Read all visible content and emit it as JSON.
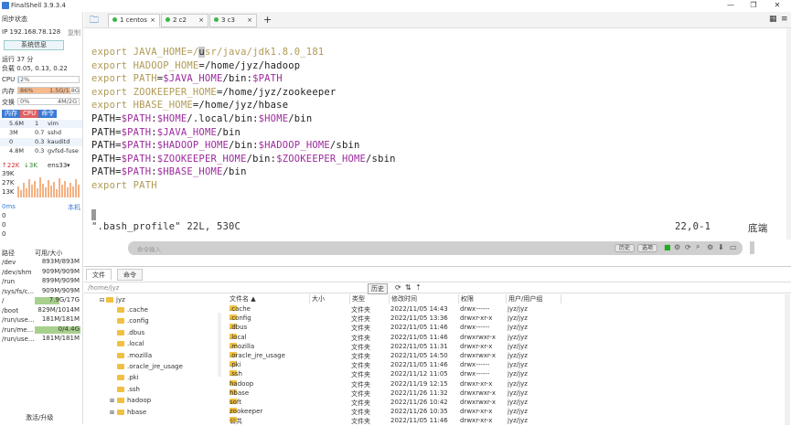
{
  "window": {
    "title": "FinalShell 3.9.3.4"
  },
  "left": {
    "sync_status": "同步状态",
    "ip": "IP 192.168.78.128",
    "copy": "复制",
    "sysinfo_button": "系统信息",
    "uptime": "运行 37 分",
    "load": "负载 0.05, 0.13, 0.22",
    "cpu_label": "CPU",
    "cpu_value": "2%",
    "cpu_fraction": 0.02,
    "mem_label": "内存",
    "mem_pct": "86%",
    "mem_value": "1.5G/1.8G",
    "mem_fraction": 0.86,
    "swap_label": "交换",
    "swap_pct": "0%",
    "swap_value": "4M/2G",
    "proc_tabs": [
      "内存",
      "CPU",
      "命令"
    ],
    "procs": [
      {
        "mem": "5.6M",
        "cpu": "1",
        "cmd": "vim"
      },
      {
        "mem": "3M",
        "cpu": "0.7",
        "cmd": "sshd"
      },
      {
        "mem": "0",
        "cpu": "0.3",
        "cmd": "kauditd"
      },
      {
        "mem": "4.8M",
        "cpu": "0.3",
        "cmd": "gvfsd-fuse"
      }
    ],
    "net_up": "↑22K",
    "net_down": "↓3K",
    "net_if": "ens33",
    "net_scale": [
      "39K",
      "27K",
      "13K"
    ],
    "ping": "0ms",
    "ping_local": "本机",
    "zeros": [
      "0",
      "0",
      "0"
    ],
    "disk_headers": [
      "路径",
      "可用/大小"
    ],
    "disks": [
      {
        "path": "/dev",
        "size": "893M/893M",
        "fraction": 0
      },
      {
        "path": "/dev/shm",
        "size": "909M/909M",
        "fraction": 0
      },
      {
        "path": "/run",
        "size": "899M/909M",
        "fraction": 0
      },
      {
        "path": "/sys/fs/c...",
        "size": "909M/909M",
        "fraction": 0
      },
      {
        "path": "/",
        "size": "7.9G/17G",
        "fraction": 0.54
      },
      {
        "path": "/boot",
        "size": "829M/1014M",
        "fraction": 0
      },
      {
        "path": "/run/use...",
        "size": "181M/181M",
        "fraction": 0
      },
      {
        "path": "/run/me...",
        "size": "0/4.4G",
        "fraction": 1.0
      },
      {
        "path": "/run/use...",
        "size": "181M/181M",
        "fraction": 0
      }
    ],
    "upgrade": "激活/升级"
  },
  "tabs": [
    {
      "label": "1 centos",
      "active": true
    },
    {
      "label": "2 c2",
      "active": false
    },
    {
      "label": "3 c3",
      "active": false
    }
  ],
  "terminal": {
    "lines": [
      [
        {
          "t": "export ",
          "c": "kw"
        },
        {
          "t": "JAVA_HOME",
          "c": "kw"
        },
        {
          "t": "=/",
          "c": "kw"
        },
        {
          "t": "u",
          "c": "df"
        },
        {
          "t": "sr/java/jdk1.8.0_181",
          "c": "kw"
        }
      ],
      [
        {
          "t": "export ",
          "c": "kw"
        },
        {
          "t": "HADOOP_HOME",
          "c": "kw"
        },
        {
          "t": "=/home/jyz/hadoop",
          "c": "df"
        }
      ],
      [
        {
          "t": "export ",
          "c": "kw"
        },
        {
          "t": "PATH",
          "c": "kw"
        },
        {
          "t": "=",
          "c": "df"
        },
        {
          "t": "$JAVA_HOME",
          "c": "vr"
        },
        {
          "t": "/bin:",
          "c": "df"
        },
        {
          "t": "$PATH",
          "c": "vr"
        }
      ],
      [
        {
          "t": "export ",
          "c": "kw"
        },
        {
          "t": "ZOOKEEPER_HOME",
          "c": "kw"
        },
        {
          "t": "=/home/jyz/zookeeper",
          "c": "df"
        }
      ],
      [
        {
          "t": "export ",
          "c": "kw"
        },
        {
          "t": "HBASE_HOME",
          "c": "kw"
        },
        {
          "t": "=/home/jyz/hbase",
          "c": "df"
        }
      ],
      [
        {
          "t": "PATH",
          "c": "df"
        },
        {
          "t": "=",
          "c": "df"
        },
        {
          "t": "$PATH",
          "c": "vr"
        },
        {
          "t": ":",
          "c": "df"
        },
        {
          "t": "$HOME",
          "c": "vr"
        },
        {
          "t": "/.local/bin:",
          "c": "df"
        },
        {
          "t": "$HOME",
          "c": "vr"
        },
        {
          "t": "/bin",
          "c": "df"
        }
      ],
      [
        {
          "t": "PATH",
          "c": "df"
        },
        {
          "t": "=",
          "c": "df"
        },
        {
          "t": "$PATH",
          "c": "vr"
        },
        {
          "t": ":",
          "c": "df"
        },
        {
          "t": "$JAVA_HOME",
          "c": "vr"
        },
        {
          "t": "/bin",
          "c": "df"
        }
      ],
      [
        {
          "t": "PATH",
          "c": "df"
        },
        {
          "t": "=",
          "c": "df"
        },
        {
          "t": "$PATH",
          "c": "vr"
        },
        {
          "t": ":",
          "c": "df"
        },
        {
          "t": "$HADOOP_HOME",
          "c": "vr"
        },
        {
          "t": "/bin:",
          "c": "df"
        },
        {
          "t": "$HADOOP_HOME",
          "c": "vr"
        },
        {
          "t": "/sbin",
          "c": "df"
        }
      ],
      [
        {
          "t": "PATH",
          "c": "df"
        },
        {
          "t": "=",
          "c": "df"
        },
        {
          "t": "$PATH",
          "c": "vr"
        },
        {
          "t": ":",
          "c": "df"
        },
        {
          "t": "$ZOOKEEPER_HOME",
          "c": "vr"
        },
        {
          "t": "/bin:",
          "c": "df"
        },
        {
          "t": "$ZOOKEEPER_HOME",
          "c": "vr"
        },
        {
          "t": "/sbin",
          "c": "df"
        }
      ],
      [
        {
          "t": "PATH",
          "c": "df"
        },
        {
          "t": "=",
          "c": "df"
        },
        {
          "t": "$PATH",
          "c": "vr"
        },
        {
          "t": ":",
          "c": "df"
        },
        {
          "t": "$HBASE_HOME",
          "c": "vr"
        },
        {
          "t": "/bin",
          "c": "df"
        }
      ],
      [
        {
          "t": "export ",
          "c": "kw"
        },
        {
          "t": "PATH",
          "c": "kw"
        }
      ]
    ],
    "status_left": "\".bash_profile\" 22L, 530C",
    "status_pos": "22,0-1",
    "status_right": "底端",
    "cmd_placeholder": "命令输入",
    "history_btn": "历史",
    "options_btn": "选项"
  },
  "bottom": {
    "tabs": [
      "文件",
      "命令"
    ],
    "path": "/home/jyz",
    "history_btn": "历史",
    "tree_root": "jyz",
    "tree": [
      ".cache",
      ".config",
      ".dbus",
      ".local",
      ".mozilla",
      ".oracle_jre_usage",
      ".pki",
      ".ssh",
      "hadoop",
      "hbase"
    ],
    "columns": [
      "文件名 ▲",
      "大小",
      "类型",
      "修改时间",
      "权限",
      "用户/用户组"
    ],
    "files": [
      {
        "name": ".cache",
        "type": "文件夹",
        "time": "2022/11/05 14:43",
        "perm": "drwx------",
        "owner": "jyz/jyz"
      },
      {
        "name": ".config",
        "type": "文件夹",
        "time": "2022/11/05 13:36",
        "perm": "drwxr-xr-x",
        "owner": "jyz/jyz"
      },
      {
        "name": ".dbus",
        "type": "文件夹",
        "time": "2022/11/05 11:46",
        "perm": "drwx------",
        "owner": "jyz/jyz"
      },
      {
        "name": ".local",
        "type": "文件夹",
        "time": "2022/11/05 11:46",
        "perm": "drwxrwxr-x",
        "owner": "jyz/jyz"
      },
      {
        "name": ".mozilla",
        "type": "文件夹",
        "time": "2022/11/05 11:31",
        "perm": "drwxr-xr-x",
        "owner": "jyz/jyz"
      },
      {
        "name": ".oracle_jre_usage",
        "type": "文件夹",
        "time": "2022/11/05 14:50",
        "perm": "drwxrwxr-x",
        "owner": "jyz/jyz"
      },
      {
        "name": ".pki",
        "type": "文件夹",
        "time": "2022/11/05 11:46",
        "perm": "drwx------",
        "owner": "jyz/jyz"
      },
      {
        "name": ".ssh",
        "type": "文件夹",
        "time": "2022/11/12 11:05",
        "perm": "drwx------",
        "owner": "jyz/jyz"
      },
      {
        "name": "hadoop",
        "type": "文件夹",
        "time": "2022/11/19 12:15",
        "perm": "drwxr-xr-x",
        "owner": "jyz/jyz"
      },
      {
        "name": "hbase",
        "type": "文件夹",
        "time": "2022/11/26 11:32",
        "perm": "drwxrwxr-x",
        "owner": "jyz/jyz"
      },
      {
        "name": "soft",
        "type": "文件夹",
        "time": "2022/11/26 10:42",
        "perm": "drwxrwxr-x",
        "owner": "jyz/jyz"
      },
      {
        "name": "zookeeper",
        "type": "文件夹",
        "time": "2022/11/26 10:35",
        "perm": "drwxr-xr-x",
        "owner": "jyz/jyz"
      },
      {
        "name": "公共",
        "type": "文件夹",
        "time": "2022/11/05 11:46",
        "perm": "drwxr-xr-x",
        "owner": "jyz/jyz"
      }
    ]
  },
  "colors": {
    "keyword": "#b09a56",
    "variable": "#9c2a9c",
    "accent": "#3a7bd5",
    "mem_bar": "#f6b98a",
    "disk_bar": "#a8d08d"
  }
}
